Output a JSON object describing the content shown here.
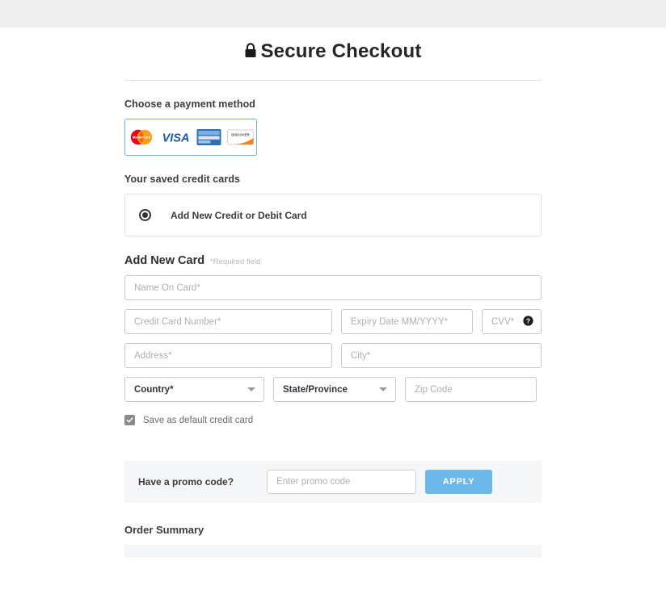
{
  "page": {
    "title": "Secure Checkout",
    "lock_icon": "lock-icon"
  },
  "payment_method": {
    "label": "Choose a payment method",
    "cards": [
      {
        "name": "mastercard-logo",
        "label": "MasterCard"
      },
      {
        "name": "visa-logo",
        "label": "VISA"
      },
      {
        "name": "amex-logo",
        "label": "American Express"
      },
      {
        "name": "discover-logo",
        "label": "DISCOVER"
      }
    ]
  },
  "saved_cards": {
    "label": "Your saved credit cards",
    "option_label": "Add New Credit or Debit Card",
    "selected": true
  },
  "add_new_card": {
    "title": "Add New Card",
    "required_note": "*Required field",
    "fields": {
      "name_on_card": "Name On Card*",
      "credit_card_number": "Credit Card Number*",
      "expiry_date": "Expiry Date MM/YYYY*",
      "cvv": "CVV*",
      "address": "Address*",
      "city": "City*",
      "country": "Country*",
      "state_province": "State/Province",
      "zip_code": "Zip Code"
    },
    "save_default_label": "Save as default credit card",
    "save_default_checked": true
  },
  "promo": {
    "label": "Have a promo code?",
    "placeholder": "Enter promo code",
    "apply_label": "APPLY",
    "apply_color": "#6cb9ea"
  },
  "order_summary": {
    "title": "Order Summary"
  }
}
